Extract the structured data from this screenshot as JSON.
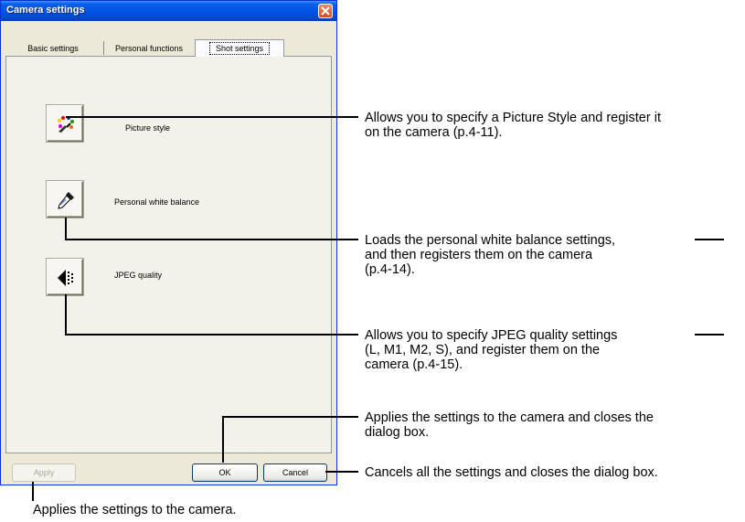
{
  "window": {
    "title": "Camera settings",
    "tabs": [
      {
        "label": "Basic settings",
        "active": false
      },
      {
        "label": "Personal functions",
        "active": false
      },
      {
        "label": "Shot settings",
        "active": true
      }
    ],
    "settings": [
      {
        "label": "Picture style",
        "icon": "picture-style-icon"
      },
      {
        "label": "Personal white balance",
        "icon": "eyedropper-icon"
      },
      {
        "label": "JPEG quality",
        "icon": "jpeg-quality-icon"
      }
    ],
    "buttons": {
      "apply": "Apply",
      "ok": "OK",
      "cancel": "Cancel"
    }
  },
  "callouts": {
    "picture_style": [
      "Allows you to specify a Picture Style and register it",
      "on the camera (p.4-11)."
    ],
    "white_balance": [
      "Loads the personal white balance settings,",
      "and then registers them on the camera",
      "(p.4-14)."
    ],
    "jpeg_quality": [
      "Allows you to specify JPEG quality settings",
      "(L, M1, M2, S), and register them on the",
      "camera (p.4-15)."
    ],
    "ok": [
      "Applies the settings to the camera and closes the",
      "dialog box."
    ],
    "cancel": [
      "Cancels all the settings and closes the dialog box."
    ],
    "apply": [
      "Applies the settings to the camera."
    ]
  },
  "colors": {
    "titlebar": "#0054e3",
    "window_bg": "#ece9d8",
    "close_button": "#d04b1c"
  }
}
